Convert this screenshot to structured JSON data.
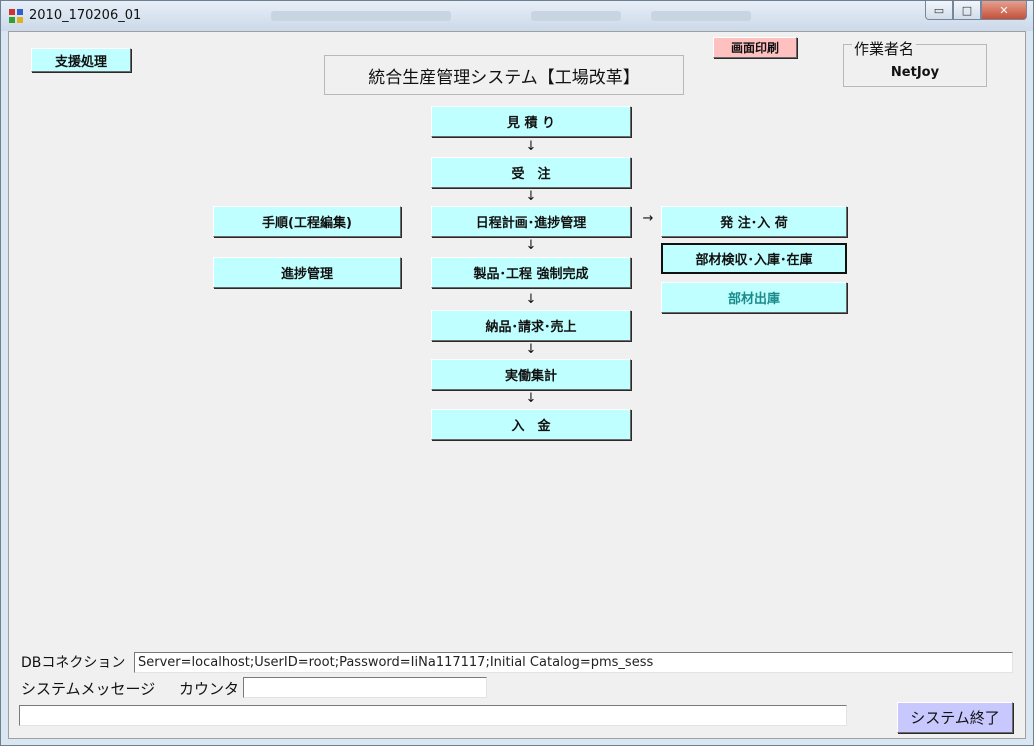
{
  "window": {
    "title": "2010_170206_01",
    "controls": {
      "minimize": "▭",
      "maximize": "□",
      "close": "✕"
    }
  },
  "header": {
    "support_button": "支援処理",
    "print_button": "画面印刷",
    "system_title": "統合生産管理システム【工場改革】",
    "worker_label": "作業者名",
    "worker_name": "NetJoy"
  },
  "flow": {
    "estimate": "見 積 り",
    "order_receipt": "受　注",
    "schedule_progress": "日程計画･進捗管理",
    "forced_completion": "製品･工程 強制完成",
    "delivery_billing": "納品･請求･売上",
    "actual_work": "実働集計",
    "payment": "入　金"
  },
  "left_buttons": {
    "procedure_edit": "手順(工程編集)",
    "progress_mgmt": "進捗管理"
  },
  "right_buttons": {
    "purchase_order": "発 注･入 荷",
    "material_inspection": "部材検収･入庫･在庫",
    "material_issue": "部材出庫"
  },
  "arrows": {
    "down": "↓",
    "right": "→"
  },
  "footer": {
    "db_label": "DBコネクション",
    "db_connection": "Server=localhost;UserID=root;Password=IiNa117117;Initial Catalog=pms_sess",
    "sysmsg_label": "システムメッセージ",
    "counter_label": "カウンタ",
    "counter_value": "",
    "system_message": "",
    "exit_button": "システム終了"
  },
  "colors": {
    "flow_button": "#c0ffff",
    "print_button": "#ffc0c0",
    "exit_button": "#c8c8ff",
    "material_issue_text": "#1a8c8c"
  }
}
